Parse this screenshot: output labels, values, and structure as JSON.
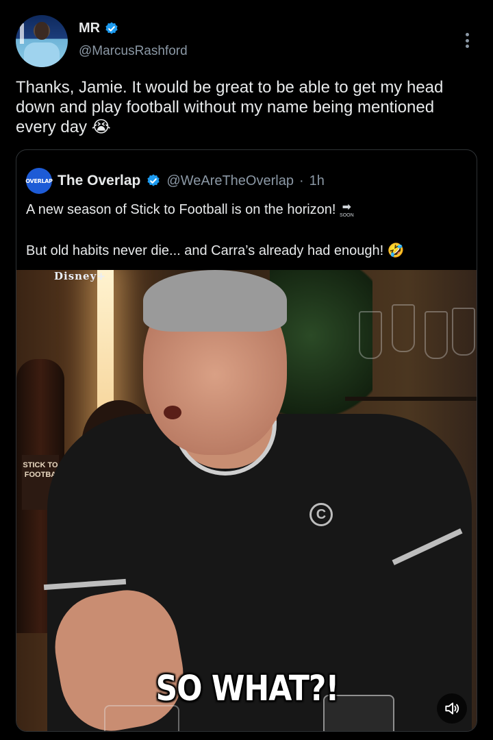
{
  "author": {
    "display_name": "MR",
    "handle": "@MarcusRashford",
    "verified": true,
    "avatar": "profile-photo"
  },
  "tweet": {
    "text": "Thanks, Jamie. It would be great to be able to get my head down and play football without my name being mentioned every day",
    "emoji": "😭"
  },
  "quote": {
    "avatar_text": "OVERLAP",
    "display_name": "The Overlap",
    "handle": "@WeAreTheOverlap",
    "separator": "·",
    "time": "1h",
    "line1": "A new season of Stick to Football is on the horizon!",
    "soon_arrow": "➡",
    "soon_label": "SOON",
    "line2": "But old habits never die... and Carra’s already had enough!",
    "line2_emoji": "🤣"
  },
  "media": {
    "watermark": "Disney+",
    "caption": "SO WHAT?!",
    "bottle_label": "STICK TO FOOTBA",
    "shirt_logo": "C",
    "mute_icon": "speaker-icon"
  },
  "colors": {
    "background": "#000000",
    "text": "#e7e9ea",
    "secondary": "#8b98a5",
    "verified": "#1d9bf0",
    "border": "#2f3336"
  }
}
